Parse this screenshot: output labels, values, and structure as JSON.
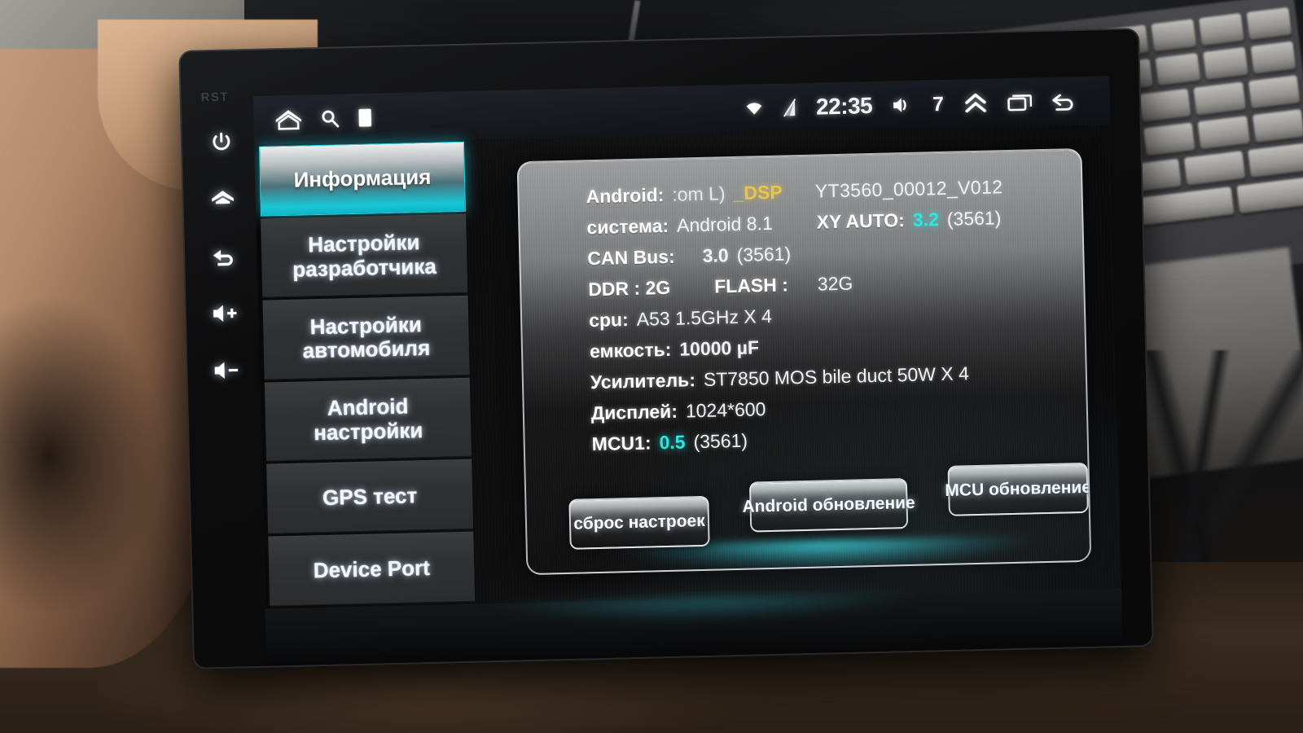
{
  "device": {
    "bezel_label": "RST",
    "hardware_buttons": [
      {
        "name": "power-button",
        "icon": "power-icon"
      },
      {
        "name": "home-button",
        "icon": "home-icon"
      },
      {
        "name": "back-button",
        "icon": "back-arrow-icon"
      },
      {
        "name": "volume-up-button",
        "icon": "volume-up-icon"
      },
      {
        "name": "volume-down-button",
        "icon": "volume-down-icon"
      }
    ]
  },
  "statusbar": {
    "left_icons": [
      {
        "name": "home-icon",
        "label": "home-icon"
      },
      {
        "name": "search-icon",
        "label": "search-icon"
      },
      {
        "name": "card-icon",
        "label": "card-icon"
      }
    ],
    "wifi_icon": "wifi-icon",
    "signal_icon": "signal-icon",
    "clock": "22:35",
    "volume_icon": "volume-icon",
    "volume_level": "7",
    "expand_icon": "chevron-double-up-icon",
    "recents_icon": "recents-icon",
    "back_icon": "back-arrow-icon"
  },
  "sidebar": {
    "items": [
      {
        "label": "Информация",
        "active": true
      },
      {
        "label": "Настройки\nразработчика",
        "active": false
      },
      {
        "label": "Настройки\nавтомобиля",
        "active": false
      },
      {
        "label": "Android\nнастройки",
        "active": false
      },
      {
        "label": "GPS тест",
        "active": false
      },
      {
        "label": "Device Port",
        "active": false
      }
    ]
  },
  "info": {
    "firmware": "YT3560_00012_V012",
    "rows": [
      {
        "key": "Android:",
        "value": ":om L)",
        "suffix": "_DSP",
        "suffix_style": "dsp"
      },
      {
        "key": "система:",
        "value": "Android 8.1",
        "key2": "XY AUTO:",
        "value2": "3.2",
        "value2_style": "cyan",
        "build2": "(3561)"
      },
      {
        "key": "CAN Bus:",
        "value": "3.0",
        "build": "(3561)"
      },
      {
        "key": "DDR : 2G",
        "key2": "FLASH :",
        "value2": "32G"
      },
      {
        "key": "cpu:",
        "value": "A53 1.5GHz X 4"
      },
      {
        "key": "емкость:",
        "value": "10000 µF"
      },
      {
        "key": "Усилитель:",
        "value": "ST7850 MOS bile duct 50W X 4"
      },
      {
        "key": "Дисплей:",
        "value": "1024*600"
      },
      {
        "key": "MCU1:",
        "value": "0.5",
        "value_style": "cyan",
        "build": "(3561)"
      }
    ]
  },
  "buttons": {
    "reset": "сброс настроек",
    "android_update": "Android обновление",
    "mcu_update": "MCU обновление"
  },
  "colors": {
    "accent_cyan": "#2ee6e0",
    "accent_yellow": "#e8c44a",
    "active_tab_gradient_end": "#0fb4c6"
  }
}
